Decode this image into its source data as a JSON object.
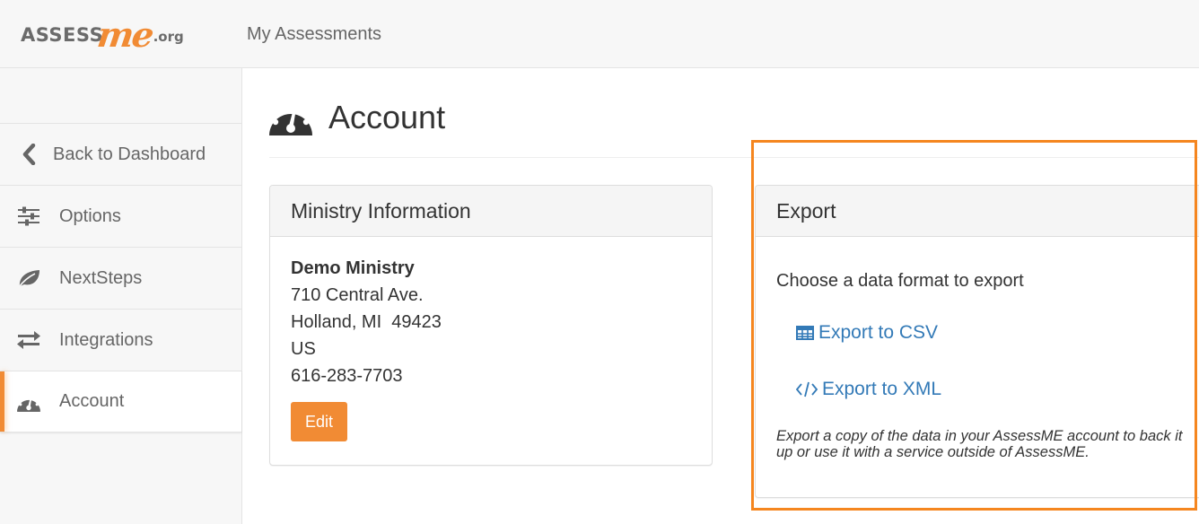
{
  "header": {
    "logo": {
      "part1": "ASSESS",
      "part2": "me",
      "part3": ".org"
    },
    "nav_link": "My Assessments"
  },
  "sidebar": {
    "items": [
      {
        "label": "Back to Dashboard",
        "icon": "chevron-left-icon",
        "active": false
      },
      {
        "label": "Options",
        "icon": "sliders-icon",
        "active": false
      },
      {
        "label": "NextSteps",
        "icon": "leaf-icon",
        "active": false
      },
      {
        "label": "Integrations",
        "icon": "exchange-icon",
        "active": true
      },
      {
        "label": "Account",
        "icon": "dashboard-gauge-icon",
        "active": true
      }
    ]
  },
  "page": {
    "title": "Account",
    "title_icon": "dashboard-gauge-icon"
  },
  "ministry_panel": {
    "heading": "Ministry Information",
    "name": "Demo Ministry",
    "address_line1": "710 Central Ave.",
    "address_line2": "Holland, MI  49423",
    "country": "US",
    "phone": "616-283-7703",
    "edit_label": "Edit"
  },
  "export_panel": {
    "heading": "Export",
    "prompt": "Choose a data format to export",
    "csv_label": "Export to CSV",
    "csv_icon": "table-icon",
    "xml_label": "Export to XML",
    "xml_icon": "code-icon",
    "note": "Export a copy of the data in your AssessME account to back it up or use it with a service outside of AssessME."
  },
  "colors": {
    "brand_orange": "#f18b34",
    "highlight_orange": "#f5861f",
    "link_blue": "#337ab7",
    "text_gray": "#666666"
  }
}
